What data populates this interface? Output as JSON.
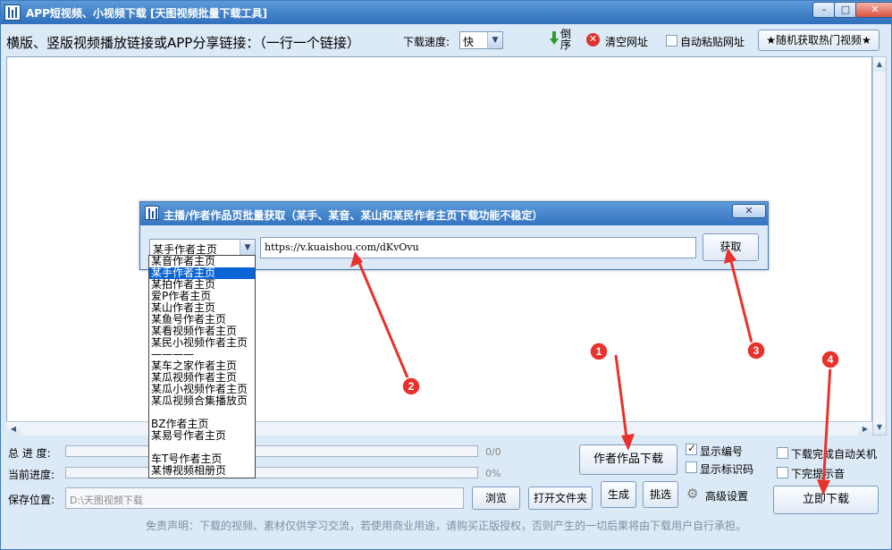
{
  "window": {
    "title": "APP短视频、小视频下载 [天图视频批量下载工具]",
    "minimize": "–",
    "maximize": "□",
    "close": "✕"
  },
  "toolbar": {
    "prompt": "横版、竖版视频播放链接或APP分享链接：（一行一个链接）",
    "speed_label": "下载速度:",
    "speed_value": "快",
    "reverse_label": "倒序",
    "clear_label": "清空网址",
    "auto_paste_label": "自动粘贴网址",
    "random_button": "★随机获取热门视频★"
  },
  "dialog": {
    "title": "主播/作者作品页批量获取（某手、某音、某山和某民作者主页下载功能不稳定）",
    "close": "✕",
    "selected": "某手作者主页",
    "url": "https://v.kuaishou.com/dKvOvu",
    "fetch_button": "获取",
    "options": [
      "某音作者主页",
      "某手作者主页",
      "某拍作者主页",
      "爱P作者主页",
      "某山作者主页",
      "某鱼号作者主页",
      "某看视频作者主页",
      "某民小视频作者主页",
      "————",
      "某车之家作者主页",
      "某瓜视频作者主页",
      "某瓜小视频作者主页",
      "某瓜视频合集播放页",
      "",
      "BZ作者主页",
      "某易号作者主页",
      "",
      "车T号作者主页",
      "某博视频相册页"
    ],
    "highlighted_index": 1
  },
  "progress": {
    "total_label": "总 进 度:",
    "total_value": "0/0",
    "total_fraction": 0,
    "current_label": "当前进度:",
    "current_value": "0%",
    "current_fraction": 0
  },
  "save": {
    "label": "保存位置:",
    "path": "D:\\天图视频下载",
    "browse": "浏览",
    "open_folder": "打开文件夹"
  },
  "actions": {
    "author_works": "作者作品下载",
    "generate": "生成",
    "pick": "挑选",
    "advanced": "高级设置",
    "show_number": "显示编号",
    "show_number_checked": true,
    "show_watermark": "显示标识码",
    "show_watermark_checked": false,
    "auto_shutdown": "下载完成自动关机",
    "auto_shutdown_checked": false,
    "done_sound": "下完提示音",
    "done_sound_checked": false,
    "download_now": "立即下载"
  },
  "annotations": [
    "1",
    "2",
    "3",
    "4"
  ],
  "disclaimer": "免责声明：下载的视频、素材仅供学习交流，若使用商业用途，请购买正版授权，否则产生的一切后果将由下载用户自行承担。",
  "colors": {
    "accent_red": "#e8322c",
    "title_blue": "#2f6fbc",
    "highlight": "#0a64d6"
  }
}
